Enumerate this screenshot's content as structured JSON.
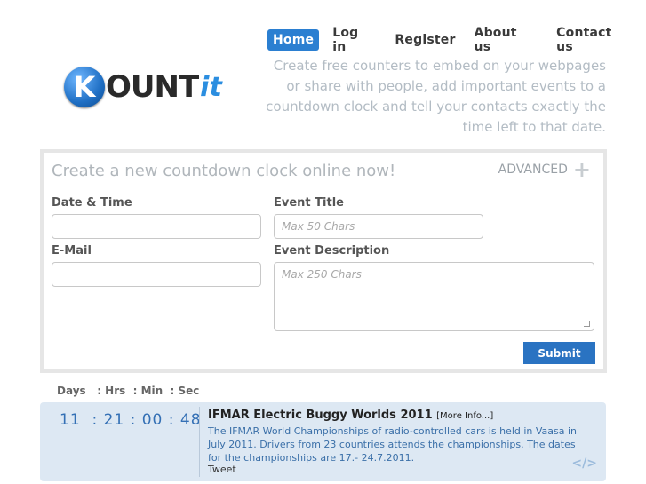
{
  "nav": {
    "items": [
      {
        "label": "Home"
      },
      {
        "label": "Log in"
      },
      {
        "label": "Register"
      },
      {
        "label": "About us"
      },
      {
        "label": "Contact us"
      }
    ]
  },
  "logo": {
    "k": "K",
    "text": "OUNT",
    "it": "it"
  },
  "tagline": "Create free counters to embed on your webpages or share with people, add important events to a countdown clock and tell your contacts exactly the time left to that date.",
  "form": {
    "title": "Create a new countdown clock online now!",
    "advanced": "ADVANCED",
    "date_label": "Date & Time",
    "email_label": "E-Mail",
    "event_title_label": "Event Title",
    "event_title_placeholder": "Max 50 Chars",
    "event_desc_label": "Event Description",
    "event_desc_placeholder": "Max 250 Chars",
    "submit": "Submit"
  },
  "countdown": {
    "header": "Days   : Hrs  : Min  : Sec",
    "timer": "11  : 21 : 00 : 48",
    "event_title": "IFMAR Electric Buggy Worlds 2011",
    "more_info": "[More Info...]",
    "description": "The IFMAR World Championships of radio-controlled cars is held in Vaasa in July 2011. Drivers from 23 countries attends the championships. The dates for the championships are 17.- 24.7.2011.",
    "tweet": "Tweet",
    "embed": "</>"
  }
}
